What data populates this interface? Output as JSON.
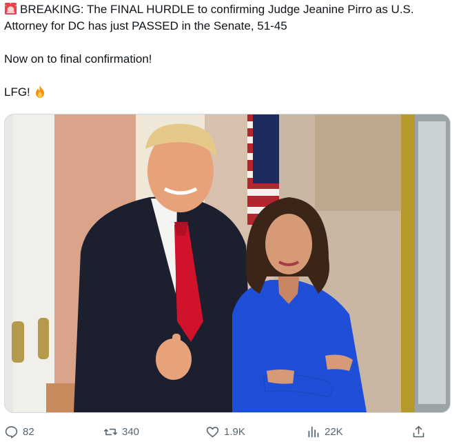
{
  "tweet": {
    "line1": "BREAKING: The FINAL HURDLE to confirming Judge Jeanine Pirro as U.S.",
    "line2": "Attorney for DC has just PASSED in the Senate, 51-45",
    "line3": "Now on to final confirmation!",
    "line4": "LFG!",
    "leading_icon": "rotating-light-icon",
    "trailing_icon": "fire-icon"
  },
  "media": {
    "icon": "photo"
  },
  "actions": {
    "replies": "82",
    "reposts": "340",
    "likes": "1.9K",
    "views": "22K"
  },
  "colors": {
    "text": "#0f1419",
    "muted": "#536471",
    "tie": "#d0122b",
    "dress": "#1f4fd6"
  }
}
